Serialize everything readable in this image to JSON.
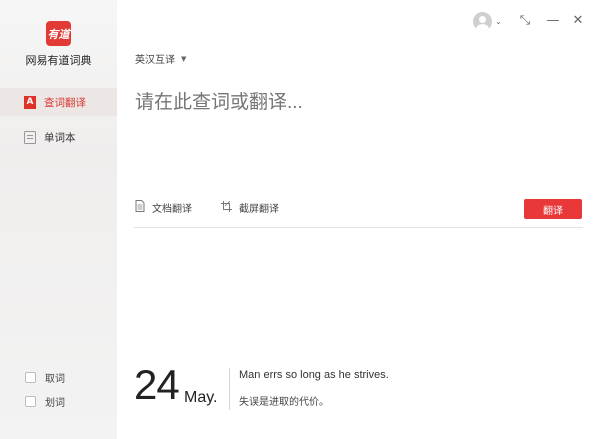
{
  "app": {
    "logo_text": "有道",
    "name": "网易有道词典"
  },
  "sidebar": {
    "items": [
      {
        "label": "查词翻译",
        "active": true
      },
      {
        "label": "单词本",
        "active": false
      }
    ],
    "checks": [
      {
        "label": "取词",
        "checked": false
      },
      {
        "label": "划词",
        "checked": false
      }
    ]
  },
  "titlebar": {
    "icons": [
      "avatar-icon",
      "chevron-down-icon",
      "mini-window-icon",
      "minimize-icon",
      "close-icon"
    ],
    "chevron": "⌄",
    "shrink": "⤡",
    "minimize": "—",
    "close": "✕"
  },
  "main": {
    "language_mode": "英汉互译",
    "query_placeholder": "请在此查词或翻译...",
    "query_value": "",
    "tools": [
      {
        "label": "文档翻译",
        "icon": "document-icon"
      },
      {
        "label": "截屏翻译",
        "icon": "crop-icon"
      }
    ],
    "translate_label": "翻译"
  },
  "daily": {
    "day": "24",
    "month": "May.",
    "quote_en": "Man errs so long as he strives.",
    "quote_zh": "失误是进取的代价。"
  },
  "colors": {
    "accent": "#e8383a",
    "sidebar_bg": "#f3f3f3",
    "active_bg": "#ece6e4"
  }
}
